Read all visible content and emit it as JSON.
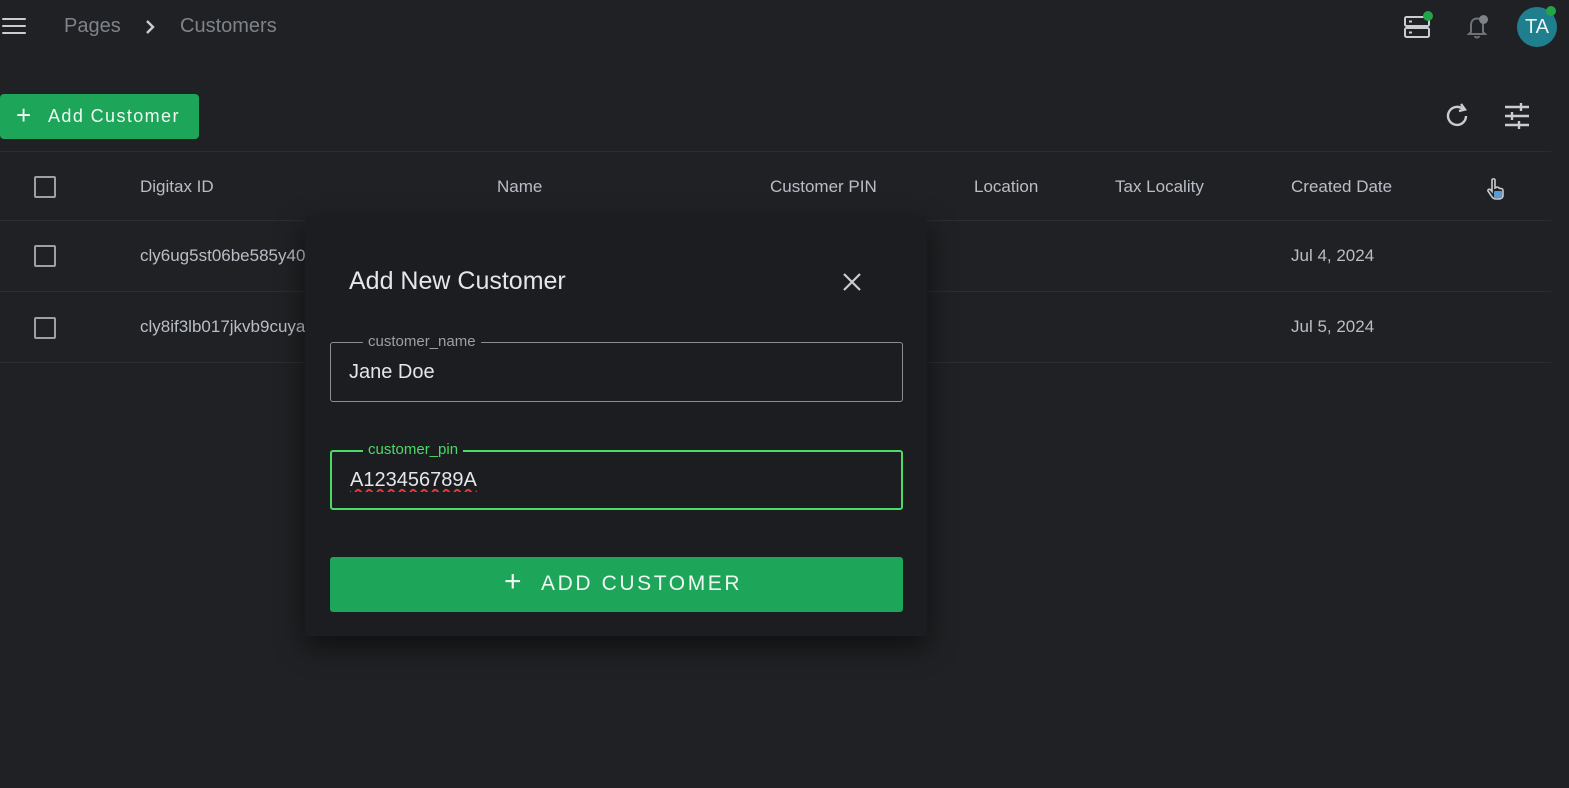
{
  "breadcrumb": {
    "root": "Pages",
    "current": "Customers"
  },
  "user": {
    "initials": "TA"
  },
  "toolbar": {
    "add_customer_label": "Add Customer"
  },
  "table": {
    "columns": [
      "Digitax ID",
      "Name",
      "Customer PIN",
      "Location",
      "Tax Locality",
      "Created Date"
    ],
    "rows": [
      {
        "digitax_id": "cly6ug5st06be585y40",
        "created_date": "Jul 4, 2024"
      },
      {
        "digitax_id": "cly8if3lb017jkvb9cuya",
        "created_date": "Jul 5, 2024"
      }
    ]
  },
  "modal": {
    "title": "Add New Customer",
    "name_field": {
      "label": "customer_name",
      "value": "Jane Doe"
    },
    "pin_field": {
      "label": "customer_pin",
      "value": "A123456789A"
    },
    "submit_label": "ADD CUSTOMER"
  },
  "colors": {
    "accent": "#1da55a",
    "focus_green": "#4cd964",
    "status_dot": "#22a447",
    "avatar_bg": "#1f7f8f",
    "background": "#202124"
  },
  "icons": {
    "menu": "menu-icon",
    "chevron": "chevron-right-icon",
    "server": "server-icon",
    "bell": "bell-icon",
    "refresh": "refresh-icon",
    "filter": "filter-sliders-icon",
    "pointer": "pointer-hand-icon",
    "close": "close-icon",
    "plus": "plus-icon"
  }
}
